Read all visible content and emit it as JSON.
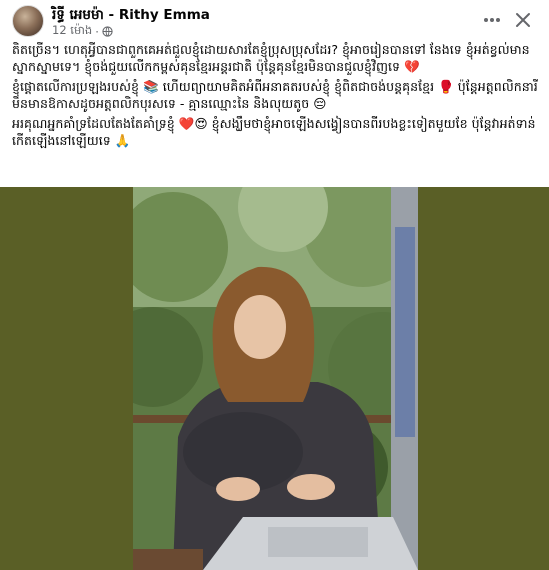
{
  "post": {
    "author": "រិទ្ធី អេមម៉ា - Rithy Emma",
    "timestamp": "12 ម៉ោង",
    "privacy_icon": "globe-icon",
    "more_icon": "more-horizontal-icon",
    "close_icon": "close-icon",
    "caption": [
      "តិតច្រើន។ ហេតុអ្វីបានជាពួកគេអត់ជួលខ្ញុំដោយសារតែខ្ញុំប្រុសប្រុសដែរ? ខ្ញុំអាចរៀនបានទៅ នែងទេ ខ្ញុំអត់ខ្វល់មានស្នាកស្នាមទេ។ ខ្ញុំចង់ជួយលើកកម្ពស់គុនខ្មែរអន្តរជាតិ ប៉ុន្តែគុនខ្មែរមិនបានជួលខ្ញុំវិញទេ 💔",
      "ខ្ញុំផ្តោតលើការប្រឡងរបស់ខ្ញុំ 📚 ហើយព្យាយាមគិតអំពីអនាគតរបស់ខ្ញុំ ខ្ញុំពិតជាចង់បន្តគុនខ្មែរ 🥊 ប៉ុន្តែអត្តពលិកនារីមិនមានឱកាសដូចអត្តពលិកបុរសទេ - គ្មានឈ្មោះនៃ និងលុយតូច 😔",
      "អរគុណអ្នកគាំទ្រដែលតែងតែគាំទ្រខ្ញុំ ❤️😍 ខ្ញុំសង្ឃឹមថាខ្ញុំអាចឡើងសង្វៀនបានពីរបងខ្លះទៀតមួយខែ ប៉ុន្តែវាអត់ទាន់កើតឡើងនៅឡើយទេ 🙏"
    ],
    "accent_color": "#e0245e",
    "media_background": "#5a5f26"
  }
}
